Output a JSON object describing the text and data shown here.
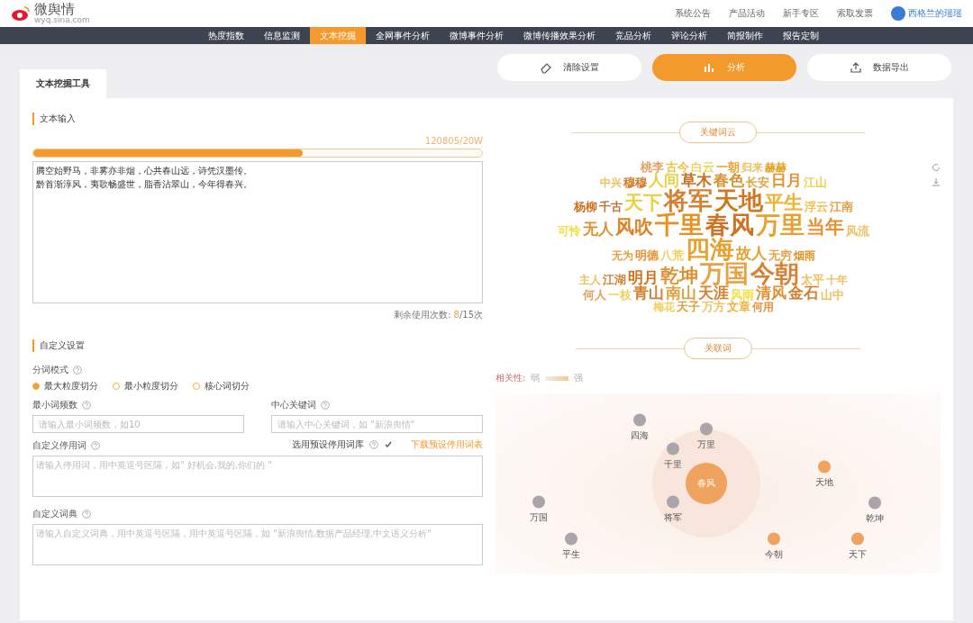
{
  "header": {
    "logo_text": "微舆情",
    "logo_sub": "wyq.sina.com",
    "links": [
      "系统公告",
      "产品活动",
      "新手专区",
      "索取发票"
    ],
    "user": "西格兰的瑶瑶"
  },
  "nav": [
    {
      "label": "热度指数",
      "selected": false
    },
    {
      "label": "信息监测",
      "selected": false
    },
    {
      "label": "文本挖掘",
      "selected": true
    },
    {
      "label": "全网事件分析",
      "selected": false
    },
    {
      "label": "微博事件分析",
      "selected": false
    },
    {
      "label": "微博传播效果分析",
      "selected": false
    },
    {
      "label": "竞品分析",
      "selected": false
    },
    {
      "label": "评论分析",
      "selected": false
    },
    {
      "label": "简报制作",
      "selected": false
    },
    {
      "label": "报告定制",
      "selected": false
    }
  ],
  "tool_tab": "文本挖掘工具",
  "actions": [
    {
      "label": "清除设置",
      "kind": "clear"
    },
    {
      "label": "分析",
      "kind": "analyze"
    },
    {
      "label": "数据导出",
      "kind": "export"
    }
  ],
  "text_input": {
    "title": "文本输入",
    "count": "120805/20W",
    "level": 0.6,
    "lines": [
      "腾空始野马，非雾亦非烟，心共春山远，诗凭汉墨传。",
      "黔首渐淳风，夷歌畅盛世，脂香沾翠山，今年得春兴。"
    ],
    "remaining_label": "剩余使用次数:",
    "remaining_used": "8",
    "remaining_total": "/15次"
  },
  "settings": {
    "title": "自定义设置",
    "mode_label": "分词模式",
    "modes": [
      {
        "label": "最大粒度切分",
        "selected": true
      },
      {
        "label": "最小粒度切分",
        "selected": false
      },
      {
        "label": "核心词切分",
        "selected": false
      }
    ],
    "min_freq": {
      "label": "最小词频数",
      "placeholder": "请输入最小词频数，如10"
    },
    "center_word": {
      "label": "中心关键词",
      "placeholder": "请输入中心关键词，如 \"新浪舆情\""
    },
    "stopwords": {
      "label": "自定义停用词",
      "placeholder": "请输入停用词，用中英逗号区隔，如\" 好机会,我的,你们的 \""
    },
    "preset": {
      "label": "选用预设停用词库",
      "checked": true,
      "link": "下载预设停用词表"
    },
    "dictionary": {
      "label": "自定义词典",
      "placeholder": "请输入自定义词典，用中英逗号区隔，用中英逗号区隔，如 \"新浪舆情,数据产品经理,中文语义分析\""
    }
  },
  "word_cloud": {
    "title": "关键词云",
    "rows": [
      [
        {
          "text": "桃李",
          "kind": "s",
          "color": "#e0a060"
        },
        {
          "text": "古今",
          "kind": "s",
          "color": "#f0c040"
        },
        {
          "text": "白云",
          "kind": "s",
          "color": "#f0d060"
        },
        {
          "text": "一朝",
          "kind": "s",
          "color": "#e8a030"
        },
        {
          "text": "归来",
          "kind": "xs",
          "color": "#f0c060"
        },
        {
          "text": "赫赫",
          "kind": "xs",
          "color": "#e0a020"
        }
      ],
      [
        {
          "text": "中兴",
          "kind": "xs",
          "color": "#f0c060"
        },
        {
          "text": "穆穆",
          "kind": "s",
          "color": "#d08030"
        },
        {
          "text": "人间",
          "kind": "m",
          "color": "#e8d040"
        },
        {
          "text": "草木",
          "kind": "m",
          "color": "#c87020"
        },
        {
          "text": "春色",
          "kind": "m",
          "color": "#d89030"
        },
        {
          "text": "长安",
          "kind": "s",
          "color": "#e0a040"
        },
        {
          "text": "日月",
          "kind": "m",
          "color": "#e09030"
        },
        {
          "text": "江山",
          "kind": "s",
          "color": "#f0d050"
        }
      ],
      [
        {
          "text": "杨柳",
          "kind": "s",
          "color": "#d07020"
        },
        {
          "text": "千古",
          "kind": "s",
          "color": "#c07030"
        },
        {
          "text": "天下",
          "kind": "l",
          "color": "#e8d040"
        },
        {
          "text": "将军",
          "kind": "xl",
          "color": "#d88030"
        },
        {
          "text": "天地",
          "kind": "xl",
          "color": "#d07820"
        },
        {
          "text": "平生",
          "kind": "l",
          "color": "#f0b030"
        },
        {
          "text": "浮云",
          "kind": "s",
          "color": "#f0c050"
        },
        {
          "text": "江南",
          "kind": "s",
          "color": "#e0a040"
        }
      ],
      [
        {
          "text": "可怜",
          "kind": "s",
          "color": "#f0e040"
        },
        {
          "text": "无人",
          "kind": "m",
          "color": "#e09030"
        },
        {
          "text": "风吹",
          "kind": "l",
          "color": "#e08020"
        },
        {
          "text": "千里",
          "kind": "xl",
          "color": "#e89020"
        },
        {
          "text": "春风",
          "kind": "xl",
          "color": "#d07020"
        },
        {
          "text": "万里",
          "kind": "xl",
          "color": "#e8a030"
        },
        {
          "text": "当年",
          "kind": "l",
          "color": "#e89030"
        },
        {
          "text": "风流",
          "kind": "s",
          "color": "#f0c060"
        }
      ],
      [
        {
          "text": "无为",
          "kind": "xs",
          "color": "#e0a040"
        },
        {
          "text": "明德",
          "kind": "s",
          "color": "#e89030"
        },
        {
          "text": "八荒",
          "kind": "s",
          "color": "#f0d060"
        },
        {
          "text": "四海",
          "kind": "xl",
          "color": "#e8a030"
        },
        {
          "text": "故人",
          "kind": "m",
          "color": "#e0a030"
        },
        {
          "text": "无穷",
          "kind": "s",
          "color": "#e8a040"
        },
        {
          "text": "烟雨",
          "kind": "xs",
          "color": "#e09020"
        }
      ],
      [
        {
          "text": "主人",
          "kind": "xs",
          "color": "#f0c060"
        },
        {
          "text": "江湖",
          "kind": "s",
          "color": "#d08030"
        },
        {
          "text": "明月",
          "kind": "m",
          "color": "#d07020"
        },
        {
          "text": "乾坤",
          "kind": "l",
          "color": "#e09030"
        },
        {
          "text": "万国",
          "kind": "xl",
          "color": "#e8a040"
        },
        {
          "text": "今朝",
          "kind": "xl",
          "color": "#d88030"
        },
        {
          "text": "太平",
          "kind": "s",
          "color": "#f0c060"
        },
        {
          "text": "十年",
          "kind": "xs",
          "color": "#f0c060"
        }
      ],
      [
        {
          "text": "何人",
          "kind": "s",
          "color": "#e0a060"
        },
        {
          "text": "一枝",
          "kind": "s",
          "color": "#f0d060"
        },
        {
          "text": "青山",
          "kind": "m",
          "color": "#d08030"
        },
        {
          "text": "南山",
          "kind": "m",
          "color": "#e0a040"
        },
        {
          "text": "天涯",
          "kind": "m",
          "color": "#d88030"
        },
        {
          "text": "风雨",
          "kind": "s",
          "color": "#f0e040"
        },
        {
          "text": "清风",
          "kind": "m",
          "color": "#e09030"
        },
        {
          "text": "金石",
          "kind": "m",
          "color": "#d08030"
        },
        {
          "text": "山中",
          "kind": "s",
          "color": "#f0c060"
        }
      ],
      [
        {
          "text": "梅花",
          "kind": "xs",
          "color": "#f0d060"
        },
        {
          "text": "天子",
          "kind": "s",
          "color": "#e0a040"
        },
        {
          "text": "万方",
          "kind": "s",
          "color": "#f0c060"
        },
        {
          "text": "文章",
          "kind": "s",
          "color": "#f0b040"
        },
        {
          "text": "何用",
          "kind": "xs",
          "color": "#e09040"
        }
      ]
    ]
  },
  "related": {
    "title": "关联词",
    "legend_label": "相关性:",
    "legend_low": "弱",
    "legend_high": "强",
    "center": "春风",
    "nodes": [
      {
        "text": "四海",
        "color": "#aaa4ab"
      },
      {
        "text": "万里",
        "color": "#aaa4ab"
      },
      {
        "text": "千里",
        "color": "#aaa4ab"
      },
      {
        "text": "将军",
        "color": "#aaa4ab"
      },
      {
        "text": "天地",
        "color": "#f0a35e"
      },
      {
        "text": "万国",
        "color": "#aaa4ab"
      },
      {
        "text": "乾坤",
        "color": "#aaa4ab"
      },
      {
        "text": "平生",
        "color": "#aaa4ab"
      },
      {
        "text": "今朝",
        "color": "#f0a35e"
      },
      {
        "text": "天下",
        "color": "#f0a35e"
      }
    ]
  }
}
